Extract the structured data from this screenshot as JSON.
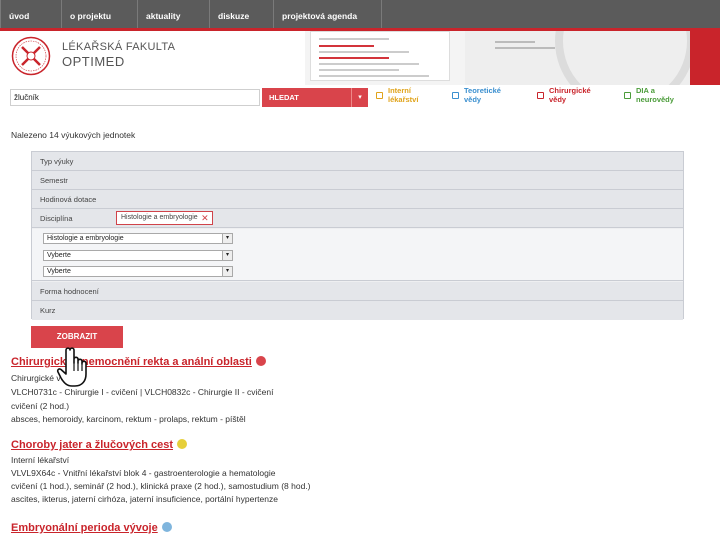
{
  "nav": [
    "úvod",
    "o projektu",
    "aktuality",
    "diskuze",
    "projektová agenda"
  ],
  "header": {
    "faculty": "LÉKAŘSKÁ FAKULTA",
    "brand": "OPTIMED"
  },
  "search": {
    "value": "žlučník",
    "button": "HLEDAT",
    "caret": "▾"
  },
  "filters": [
    {
      "label_lines": [
        "Interní",
        "lékařství"
      ],
      "color": "#e0a31a"
    },
    {
      "label_lines": [
        "Teoretické",
        "vědy"
      ],
      "color": "#3a8fcf"
    },
    {
      "label_lines": [
        "Chirurgické",
        "vědy"
      ],
      "color": "#c9242b"
    },
    {
      "label_lines": [
        "DIA a",
        "neurovědy"
      ],
      "color": "#4b9c3a"
    }
  ],
  "found_text": "Nalezeno 14 výukových jednotek",
  "panel": {
    "rows": [
      "Typ výuky",
      "Semestr",
      "Hodinová dotace",
      "Disciplína"
    ],
    "tag": "Histologie a embryologie",
    "tag_close": "✕",
    "selects": [
      "Histologie a embryologie",
      "Vyberte",
      "Vyberte"
    ],
    "bottom_rows": [
      "Forma hodnocení",
      "Kurz"
    ]
  },
  "show_button": "ZOBRAZIT",
  "results": [
    {
      "title": "Chirurgická onemocnění rekta a anální oblasti",
      "dot": "#d9444b",
      "lines": [
        "Chirurgické vědy",
        "VLCH0731c - Chirurgie I - cvičení | VLCH0832c - Chirurgie II - cvičení",
        "cvičení (2 hod.)",
        "absces, hemoroidy, karcinom, rektum - prolaps, rektum - píštěl"
      ]
    },
    {
      "title": "Choroby jater a žlučových cest",
      "dot": "#e6cf3a",
      "lines": [
        "Interní lékařství",
        "VLVL9X64c - Vnitřní lékařství blok 4 - gastroenterologie a hematologie",
        "cvičení (1 hod.), seminář (2 hod.), klinická praxe (2 hod.), samostudium (8 hod.)",
        "ascites, ikterus, jaterní cirhóza, jaterní insuficience, portální hypertenze"
      ]
    },
    {
      "title": "Embryonální perioda vývoje",
      "dot": "#7fb5dd",
      "lines": []
    }
  ]
}
